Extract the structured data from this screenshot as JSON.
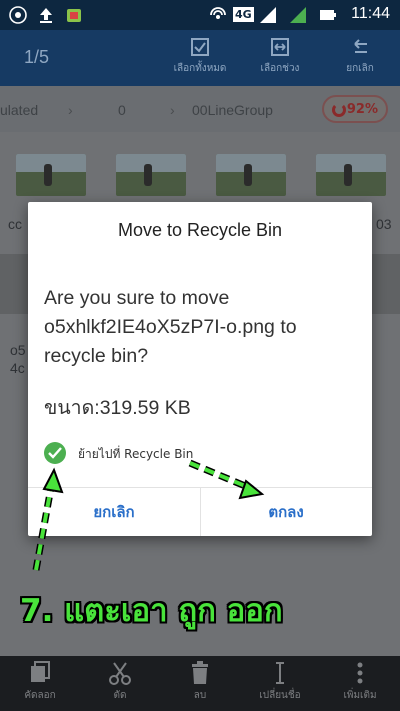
{
  "status_bar": {
    "time": "11:44",
    "network": "4G",
    "icons": [
      "wifi-icon",
      "upload-icon",
      "android-icon",
      "hotspot-icon",
      "signal-icon",
      "battery-icon"
    ]
  },
  "header": {
    "selection_count": "1/5",
    "actions": [
      {
        "label": "เลือกทั้งหมด",
        "icon": "select-all-icon"
      },
      {
        "label": "เลือกช่วง",
        "icon": "select-range-icon"
      },
      {
        "label": "ยกเลิก",
        "icon": "undo-icon"
      }
    ]
  },
  "breadcrumb": {
    "items": [
      "ulated",
      "0",
      "00LineGroup"
    ],
    "storage_percent": "92%"
  },
  "background": {
    "file_labels": [
      "cc",
      "03",
      "o5",
      "4c"
    ]
  },
  "dialog": {
    "title": "Move to Recycle Bin",
    "message": "Are you sure to move o5xhlkf2IE4oX5zP7I-o.png to recycle bin?",
    "size_text": "ขนาด:319.59 KB",
    "checkbox_label": "ย้ายไปที่ Recycle Bin",
    "checkbox_checked": true,
    "cancel_label": "ยกเลิก",
    "ok_label": "ตกลง",
    "accent_color": "#2a6fc9"
  },
  "annotation": {
    "text": "7. แตะเอา ถูก ออก",
    "color": "#49e33b"
  },
  "bottom_bar": {
    "items": [
      {
        "label": "คัดลอก",
        "icon": "copy-icon"
      },
      {
        "label": "ตัด",
        "icon": "cut-icon"
      },
      {
        "label": "ลบ",
        "icon": "trash-icon"
      },
      {
        "label": "เปลี่ยนชื่อ",
        "icon": "rename-icon"
      },
      {
        "label": "เพิ่มเติม",
        "icon": "more-icon"
      }
    ]
  }
}
